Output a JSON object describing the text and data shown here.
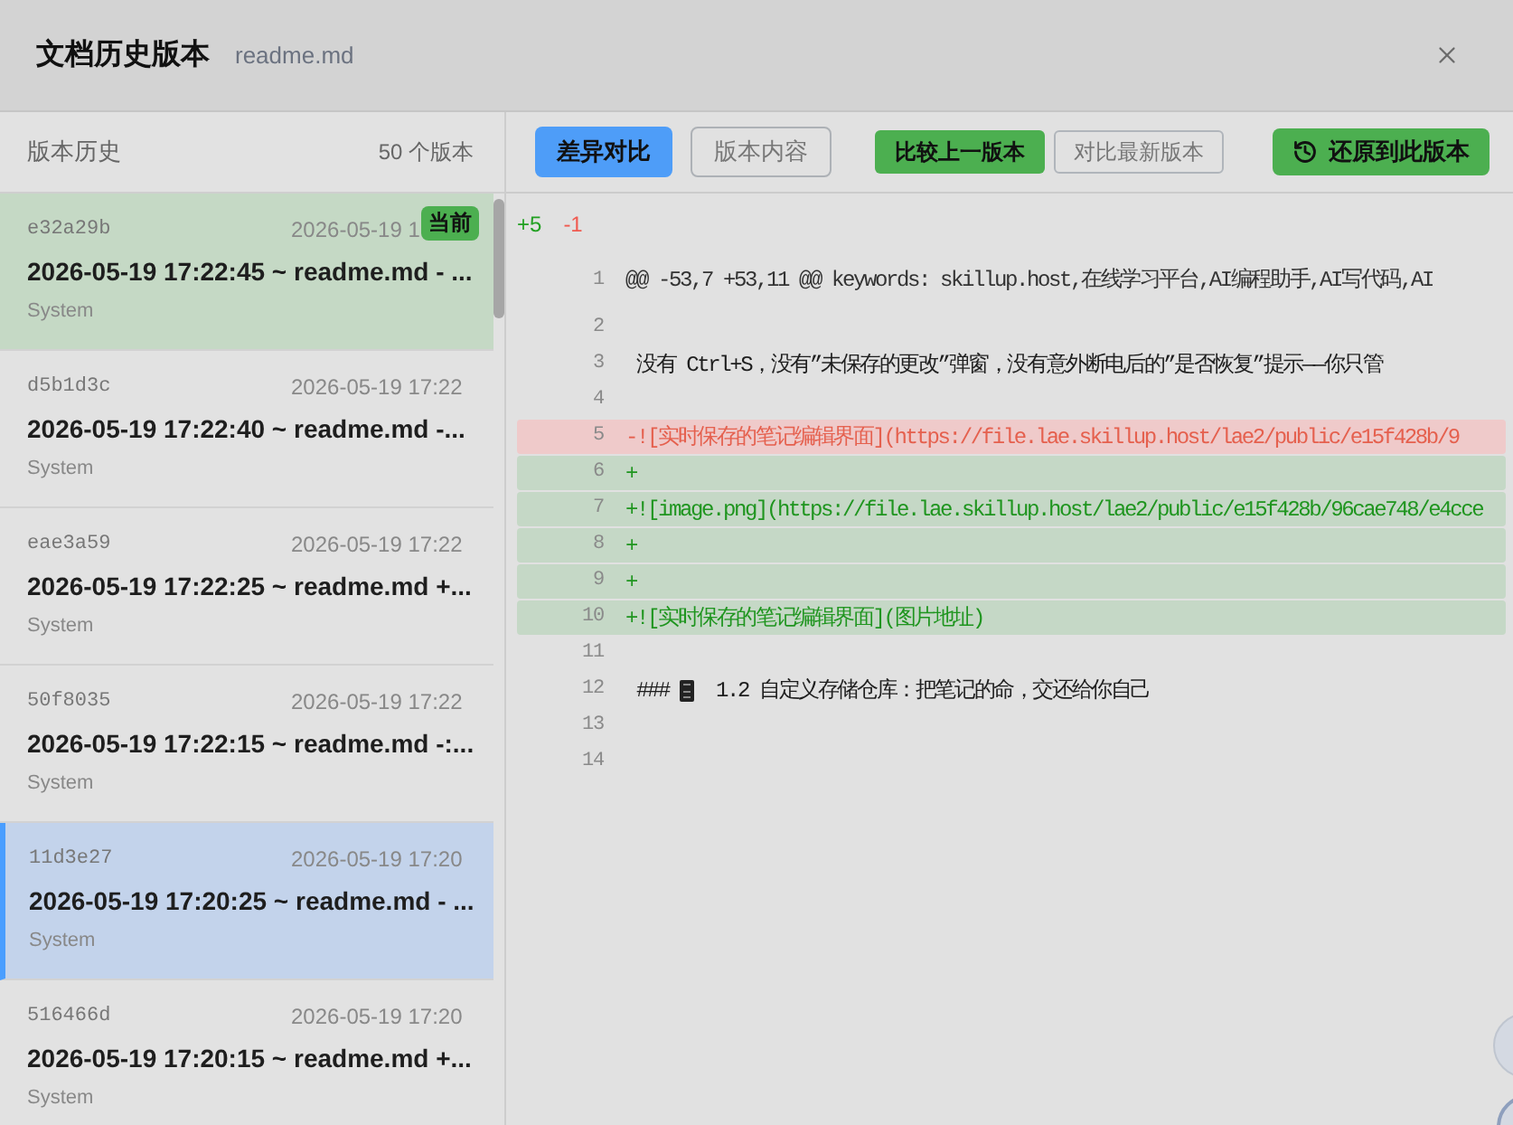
{
  "dialog": {
    "title": "文档历史版本",
    "filename": "readme.md"
  },
  "sidebar": {
    "title": "版本历史",
    "count": "50 个版本",
    "versions": [
      {
        "hash": "e32a29b",
        "time": "2026-05-19 1",
        "summary": "2026-05-19 17:22:45 ~ readme.md - ...",
        "author": "System",
        "current": true,
        "badge": "当前",
        "selected": false
      },
      {
        "hash": "d5b1d3c",
        "time": "2026-05-19 17:22",
        "summary": "2026-05-19 17:22:40 ~ readme.md -...",
        "author": "System",
        "current": false,
        "selected": false
      },
      {
        "hash": "eae3a59",
        "time": "2026-05-19 17:22",
        "summary": "2026-05-19 17:22:25 ~ readme.md +...",
        "author": "System",
        "current": false,
        "selected": false
      },
      {
        "hash": "50f8035",
        "time": "2026-05-19 17:22",
        "summary": "2026-05-19 17:22:15 ~ readme.md -:...",
        "author": "System",
        "current": false,
        "selected": false
      },
      {
        "hash": "11d3e27",
        "time": "2026-05-19 17:20",
        "summary": "2026-05-19 17:20:25 ~ readme.md - ...",
        "author": "System",
        "current": false,
        "selected": true
      },
      {
        "hash": "516466d",
        "time": "2026-05-19 17:20",
        "summary": "2026-05-19 17:20:15 ~ readme.md +...",
        "author": "System",
        "current": false,
        "selected": false
      }
    ]
  },
  "toolbar": {
    "view_tabs": [
      {
        "label": "差异对比",
        "selected": true
      },
      {
        "label": "版本内容",
        "selected": false
      }
    ],
    "compare_modes": [
      {
        "label": "比较上一版本",
        "selected": true
      },
      {
        "label": "对比最新版本",
        "selected": false
      }
    ],
    "restore_button": "还原到此版本"
  },
  "diff": {
    "added": "+5",
    "removed": "-1",
    "lines": [
      {
        "number": "1",
        "kind": "hunk",
        "text": "@@ -53,7 +53,11 @@ keywords: skillup.host,在线学习平台,AI编程助手,AI写代码,AI"
      },
      {
        "number": "2",
        "kind": "context"
      },
      {
        "number": "3",
        "kind": "context",
        "text": "没有 Ctrl+S，没有”未保存的更改”弹窗，没有意外断电后的”是否恢复”提示——你只管"
      },
      {
        "number": "4",
        "kind": "context"
      },
      {
        "number": "5",
        "kind": "removed",
        "text": "-![实时保存的笔记编辑界面](https://file.lae.skillup.host/lae2/public/e15f428b/9"
      },
      {
        "number": "6",
        "kind": "added",
        "text": "+"
      },
      {
        "number": "7",
        "kind": "added",
        "text": "+![image.png](https://file.lae.skillup.host/lae2/public/e15f428b/96cae748/e4cce"
      },
      {
        "number": "8",
        "kind": "added",
        "text": "+"
      },
      {
        "number": "9",
        "kind": "added",
        "text": "+"
      },
      {
        "number": "10",
        "kind": "added",
        "text": "+![实时保存的笔记编辑界面](图片地址)"
      },
      {
        "number": "11",
        "kind": "context"
      },
      {
        "number": "12",
        "kind": "context",
        "text": "###",
        "icon": true,
        "text_after": "1.2 自定义存储仓库：把笔记的命，交还给你自己"
      },
      {
        "number": "13",
        "kind": "context"
      },
      {
        "number": "14",
        "kind": "context"
      }
    ]
  }
}
